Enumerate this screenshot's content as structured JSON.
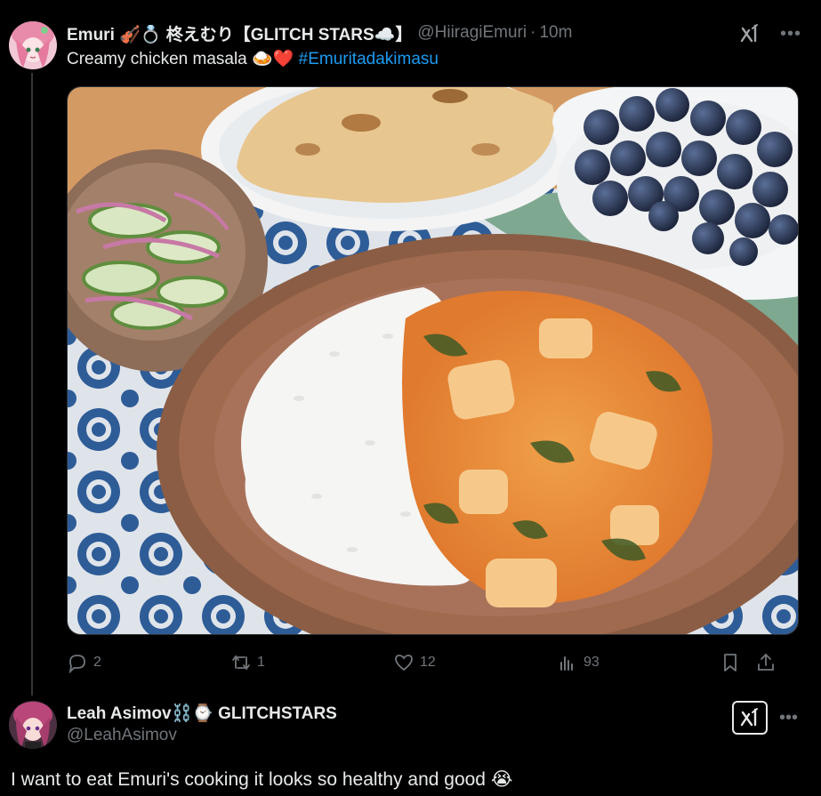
{
  "post": {
    "author_name": "Emuri 🎻💍 柊えむり【GLITCH STARS☁️】",
    "author_handle": "@HiiragiEmuri",
    "separator": "·",
    "timestamp": "10m",
    "text": "Creamy chicken masala 🍛❤️ ",
    "hashtag": "#Emuritadakimasu",
    "media_alt": "Chicken masala with rice, cucumber salad, naan and blueberries",
    "actions": {
      "replies": "2",
      "reposts": "1",
      "likes": "12",
      "views": "93"
    }
  },
  "reply": {
    "author_name": "Leah Asimov⛓️⌚ GLITCHSTARS",
    "author_handle": "@LeahAsimov",
    "text": "I want to eat Emuri's cooking it looks so healthy and good 😭"
  },
  "icons": {
    "more": "more-icon",
    "xai": "xai-grok-icon",
    "reply": "reply-icon",
    "repost": "repost-icon",
    "like": "heart-icon",
    "views": "views-icon",
    "bookmark": "bookmark-icon",
    "share": "share-icon"
  },
  "colors": {
    "background": "#000000",
    "text": "#e7e9ea",
    "muted": "#71767b",
    "link": "#1d9bf0",
    "divider": "#333639"
  }
}
